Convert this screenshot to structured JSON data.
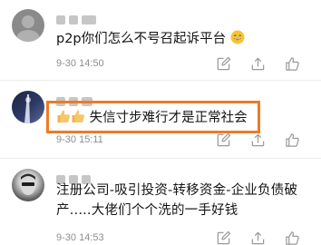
{
  "comments": [
    {
      "text": "p2p你们怎么不号召起诉平台",
      "timestamp": "9-30 14:50"
    },
    {
      "text": "失信寸步难行才是正常社会",
      "timestamp": "9-30 15:11"
    },
    {
      "text_line1": "注册公司-吸引投资-转移资金-企业负债破",
      "text_line2": "产.....大佬们个个洗的一手好钱",
      "timestamp": "9-30 14:53"
    }
  ],
  "colors": {
    "highlight": "#ef7a26",
    "meta_text": "#8e8e8e"
  },
  "icons": [
    "pencil-square-icon",
    "share-arrow-icon",
    "thumbs-up-icon"
  ]
}
